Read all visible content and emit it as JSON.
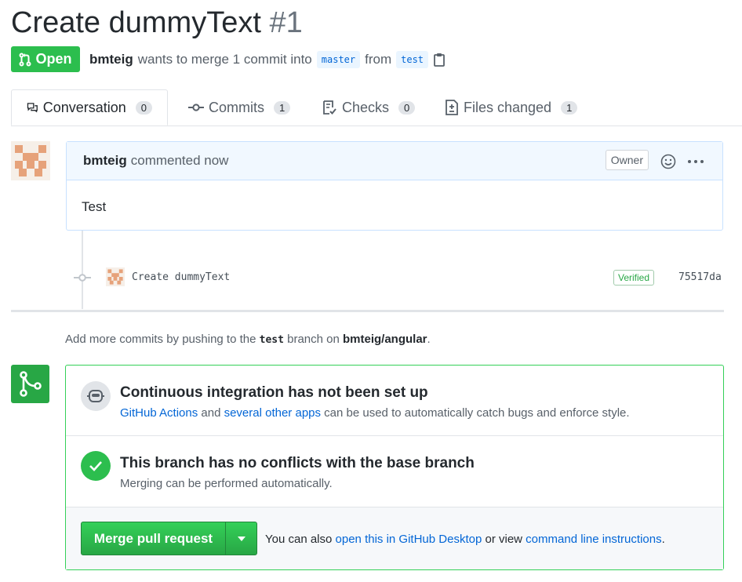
{
  "pr": {
    "title": "Create dummyText",
    "number": "#1"
  },
  "state": {
    "label": "Open",
    "color": "#2cbe4e"
  },
  "meta": {
    "author": "bmteig",
    "action": "wants to merge 1 commit into",
    "base": "master",
    "from": "from",
    "head": "test"
  },
  "tabs": [
    {
      "label": "Conversation",
      "count": "0",
      "icon": "comment-discussion-icon"
    },
    {
      "label": "Commits",
      "count": "1",
      "icon": "git-commit-icon"
    },
    {
      "label": "Checks",
      "count": "0",
      "icon": "checklist-icon"
    },
    {
      "label": "Files changed",
      "count": "1",
      "icon": "file-diff-icon"
    }
  ],
  "comment": {
    "author": "bmteig",
    "time": "commented now",
    "badge": "Owner",
    "body": "Test"
  },
  "commit": {
    "message": "Create dummyText",
    "verified": "Verified",
    "sha": "75517da"
  },
  "hint": {
    "pre": "Add more commits by pushing to the",
    "branch": "test",
    "mid": "branch on",
    "repo": "bmteig/angular",
    "end": "."
  },
  "ci": {
    "title": "Continuous integration has not been set up",
    "link1": "GitHub Actions",
    "and": "and",
    "link2": "several other apps",
    "rest": "can be used to automatically catch bugs and enforce style."
  },
  "conflicts": {
    "title": "This branch has no conflicts with the base branch",
    "desc": "Merging can be performed automatically."
  },
  "merge": {
    "button": "Merge pull request",
    "pre": "You can also",
    "link1": "open this in GitHub Desktop",
    "mid": "or view",
    "link2": "command line instructions",
    "end": "."
  },
  "colors": {
    "green": "#28a745",
    "link": "#0366d6",
    "avatar": "#e6a27a"
  }
}
